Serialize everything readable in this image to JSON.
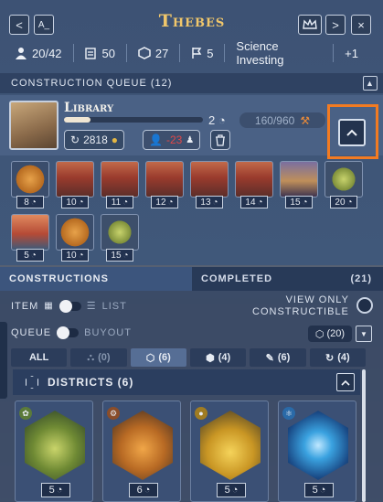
{
  "header": {
    "city_name": "Thebes",
    "prev_label": "<",
    "rename_label": "A_",
    "next_label": ">",
    "close_label": "×"
  },
  "stats": {
    "population": "20/42",
    "stability": "50",
    "districts": "27",
    "territories": "5",
    "project": "Science Investing",
    "bonus": "+1"
  },
  "queue": {
    "title": "CONSTRUCTION QUEUE (12)",
    "current": {
      "name": "Library",
      "progress_fraction": 0.19,
      "turns": "2",
      "cost": "160/960",
      "buyout_cost": "2818",
      "pop_cost": "-23"
    },
    "items_row1": [
      {
        "turns": "8",
        "icon": "gear"
      },
      {
        "turns": "10",
        "icon": "hero"
      },
      {
        "turns": "11",
        "icon": "hero"
      },
      {
        "turns": "12",
        "icon": "hero"
      },
      {
        "turns": "13",
        "icon": "hero"
      },
      {
        "turns": "14",
        "icon": "hero"
      },
      {
        "turns": "15",
        "icon": "hero2"
      },
      {
        "turns": "20",
        "icon": "wheat"
      }
    ],
    "items_row2": [
      {
        "turns": "5",
        "icon": "ship"
      },
      {
        "turns": "10",
        "icon": "gear"
      },
      {
        "turns": "15",
        "icon": "wheat"
      }
    ]
  },
  "tabs": {
    "constructions": "CONSTRUCTIONS",
    "completed": "COMPLETED",
    "completed_count": "(21)"
  },
  "options": {
    "item_label": "ITEM",
    "list_label": "LIST",
    "queue_label": "QUEUE",
    "buyout_label": "BUYOUT",
    "view_only_line1": "VIEW ONLY",
    "view_only_line2": "CONSTRUCTIBLE",
    "count": "(20)"
  },
  "filters": [
    {
      "label": "ALL"
    },
    {
      "label": "(0)"
    },
    {
      "label": "(6)"
    },
    {
      "label": "(4)"
    },
    {
      "label": "(6)"
    },
    {
      "label": "(4)"
    }
  ],
  "districts": {
    "title": "DISTRICTS (6)",
    "cards": [
      {
        "turns": "5"
      },
      {
        "turns": "6"
      },
      {
        "turns": "5"
      },
      {
        "turns": "5"
      }
    ]
  },
  "colors": {
    "accent_highlight": "#f27b22",
    "title_gold": "#f1c76b",
    "negative": "#e04848"
  }
}
